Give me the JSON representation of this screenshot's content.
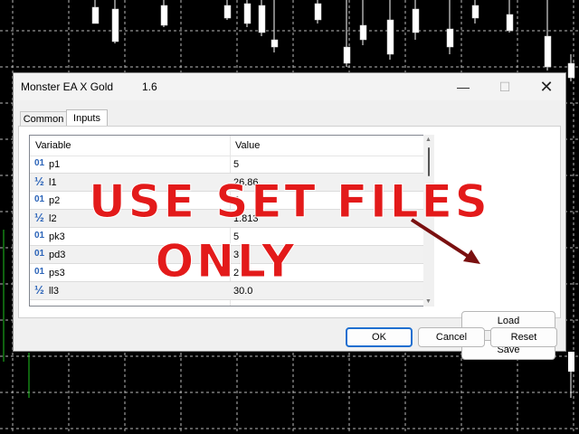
{
  "dialog": {
    "title": "Monster EA X Gold",
    "version": "1.6",
    "minimize_glyph": "—",
    "maximize_glyph": "☐",
    "close_glyph": "✕"
  },
  "tabs": [
    {
      "label": "Common",
      "active": false
    },
    {
      "label": "Inputs",
      "active": true
    }
  ],
  "table": {
    "col_variable": "Variable",
    "col_value": "Value",
    "rows": [
      {
        "icon": "01",
        "name": "p1",
        "value": "5"
      },
      {
        "icon": "½",
        "name": "l1",
        "value": "26.86"
      },
      {
        "icon": "01",
        "name": "p2",
        "value": "5"
      },
      {
        "icon": "½",
        "name": "l2",
        "value": "1.813"
      },
      {
        "icon": "01",
        "name": "pk3",
        "value": "5"
      },
      {
        "icon": "01",
        "name": "pd3",
        "value": "3"
      },
      {
        "icon": "01",
        "name": "ps3",
        "value": "2"
      },
      {
        "icon": "½",
        "name": "ll3",
        "value": "30.0"
      }
    ]
  },
  "buttons": {
    "load": "Load",
    "save": "Save",
    "ok": "OK",
    "cancel": "Cancel",
    "reset": "Reset"
  },
  "overlay": {
    "line1": "USE SET FILES",
    "line2": "ONLY",
    "color": "#e31a1a"
  },
  "icons": {
    "integer_type": "int-type-icon",
    "double_type": "double-type-icon",
    "arrow": "red-arrow"
  }
}
